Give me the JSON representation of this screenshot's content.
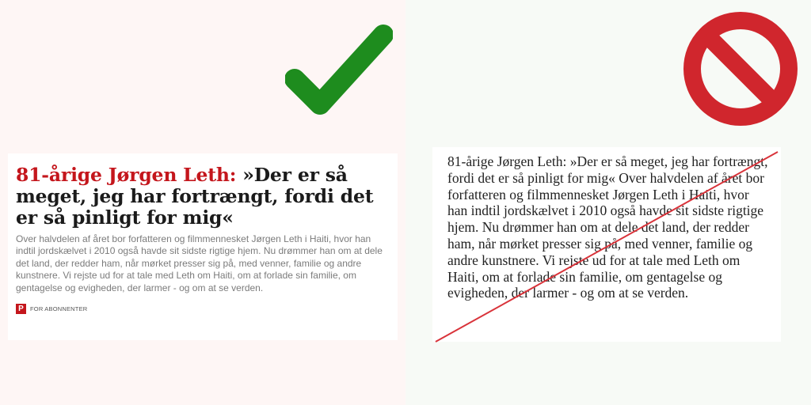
{
  "good_example": {
    "headline_kicker": "81-årige Jørgen Leth:",
    "headline_quote": "»Der er så meget, jeg har fortrængt, fordi det er så pinligt for mig«",
    "lead": "Over halvdelen af året bor forfatteren og filmmennesket Jørgen Leth i Haiti, hvor han indtil jordskælvet i 2010 også havde sit sidste rigtige hjem. Nu drømmer han om at dele det land, der redder ham, når mørket presser sig på, med venner, familie og andre kunstnere. Vi rejste ud for at tale med Leth om Haiti, om at forlade sin familie, om gentagelse og evigheden, der larmer - og om at se verden.",
    "badge_logo": "P",
    "badge_label": "FOR ABONNENTER"
  },
  "bad_example": {
    "text": "81-årige Jørgen Leth: »Der er så meget, jeg har fortrængt, fordi det er så pinligt for mig« Over halvdelen af året bor forfatteren og filmmennesket Jørgen Leth i Haiti, hvor han indtil jordskælvet i 2010 også havde sit sidste rigtige hjem. Nu drømmer han om at dele det land, der redder ham, når mørket presser sig på, med venner, familie og andre kunstnere. Vi rejste ud for at tale med Leth om Haiti, om at forlade sin familie, om gentagelse og evigheden, der larmer - og om at se verden."
  },
  "icons": {
    "approve": "checkmark-icon",
    "reject": "prohibited-icon"
  },
  "colors": {
    "accent_red": "#c4161c",
    "check_green": "#1e8c1e",
    "stop_red": "#d0262d",
    "strike_red": "#d9333a"
  }
}
